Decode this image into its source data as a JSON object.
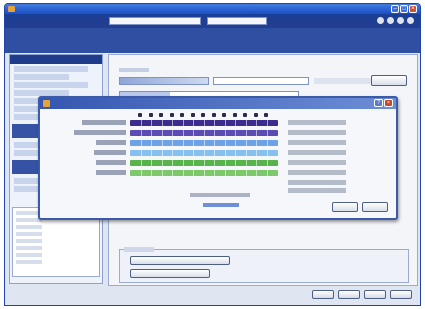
{
  "window": {
    "title": "",
    "navbar_text": "",
    "subbar_text": ""
  },
  "content": {
    "title": ""
  },
  "dialog": {
    "title": "",
    "rows": [
      {
        "name": "",
        "status": "",
        "color": "#3d2c8d"
      },
      {
        "name": "",
        "status": "",
        "color": "#5a4cb3"
      },
      {
        "name": "",
        "status": "",
        "color": "#6da3e6"
      },
      {
        "name": "",
        "status": "",
        "color": "#86c0ef"
      },
      {
        "name": "",
        "status": "",
        "color": "#58b34a"
      },
      {
        "name": "",
        "status": "",
        "color": "#7cc86a"
      }
    ]
  },
  "colors": {
    "titlebar": "#1b4ec5",
    "navbar": "#1a3f96",
    "dialog_title": "#3556b0"
  },
  "icons": {
    "app": "app-icon",
    "dialog": "dialog-icon",
    "minimize": "minimize-icon",
    "maximize": "maximize-icon",
    "close": "close-icon"
  }
}
